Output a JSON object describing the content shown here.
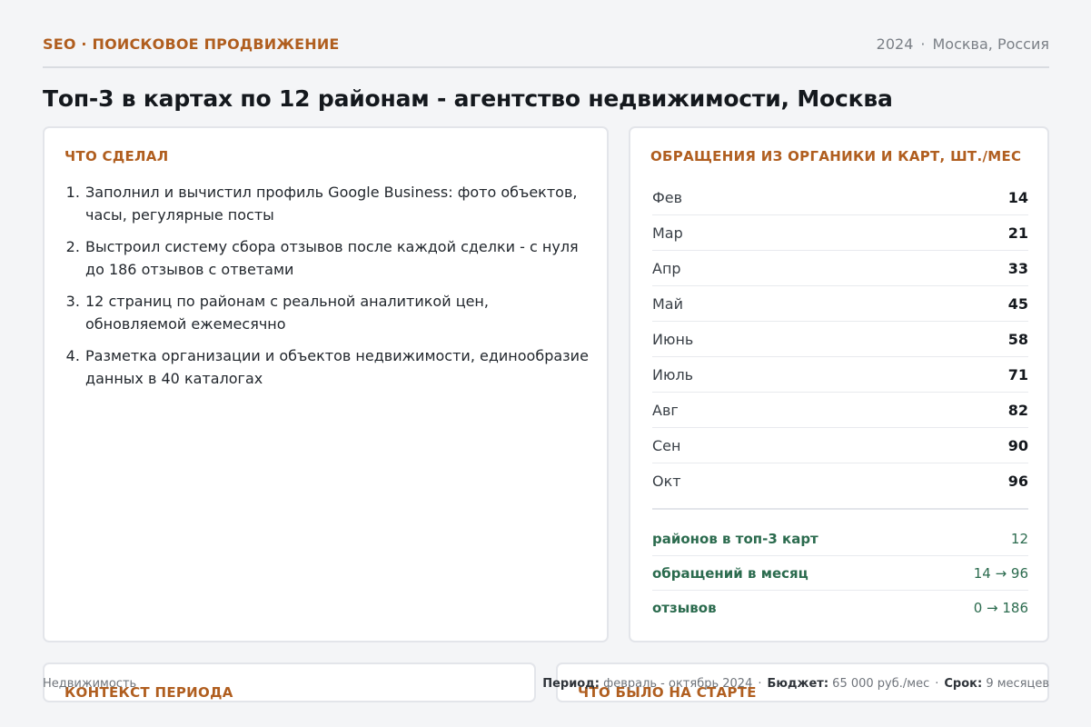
{
  "header": {
    "kicker": "SEO · ПОИСКОВОЕ ПРОДВИЖЕНИЕ",
    "year": "2024",
    "location": "Москва, Россия"
  },
  "title": "Топ-3 в картах по 12 районам - агентство недвижимости, Москва",
  "work": {
    "heading": "Что сделал",
    "steps": [
      "Заполнил и вычистил профиль Google Business: фото объектов, часы, регулярные посты",
      "Выстроил систему сбора отзывов после каждой сделки - с нуля до 186 отзывов с ответами",
      "12 страниц по районам с реальной аналитикой цен, обновляемой ежемесячно",
      "Разметка организации и объектов недвижимости, единообразие данных в 40 каталогах"
    ]
  },
  "stats": {
    "heading": "Обращения из органики и карт, шт./мес",
    "months": [
      {
        "month": "Фев",
        "value": "14"
      },
      {
        "month": "Мар",
        "value": "21"
      },
      {
        "month": "Апр",
        "value": "33"
      },
      {
        "month": "Май",
        "value": "45"
      },
      {
        "month": "Июнь",
        "value": "58"
      },
      {
        "month": "Июль",
        "value": "71"
      },
      {
        "month": "Авг",
        "value": "82"
      },
      {
        "month": "Сен",
        "value": "90"
      },
      {
        "month": "Окт",
        "value": "96"
      }
    ],
    "totals": [
      {
        "label": "районов в топ-3 карт",
        "value": "12"
      },
      {
        "label": "обращений в месяц",
        "value": "14 → 96"
      },
      {
        "label": "отзывов",
        "value": "0 → 186"
      }
    ]
  },
  "context": {
    "heading": "Контекст периода"
  },
  "start": {
    "heading": "Что было на старте"
  },
  "footer": {
    "industry": "Недвижимость",
    "period_label": "Период:",
    "period": "февраль - октябрь 2024",
    "budget_label": "Бюджет:",
    "budget": "65 000 руб./мес",
    "term_label": "Срок:",
    "term": "9 месяцев"
  },
  "colors": {
    "accent": "#b05e1f",
    "positive": "#2b6b4e"
  }
}
